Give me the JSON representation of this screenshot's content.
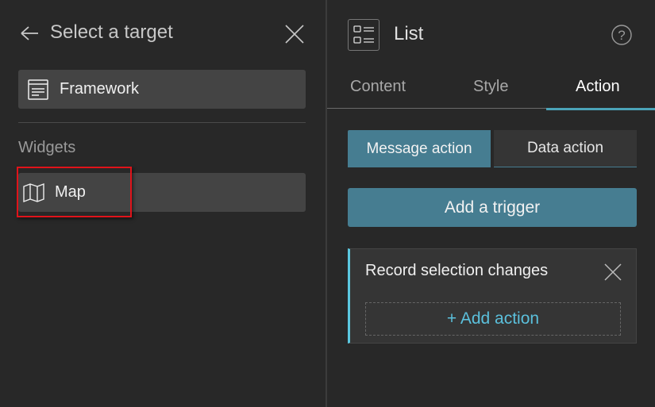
{
  "left_panel": {
    "title": "Select a target",
    "framework_label": "Framework",
    "section_label": "Widgets",
    "widgets": [
      {
        "label": "Map",
        "icon": "map-icon"
      }
    ]
  },
  "right_panel": {
    "widget_name": "List",
    "tabs": [
      {
        "label": "Content"
      },
      {
        "label": "Style"
      },
      {
        "label": "Action",
        "active": true
      }
    ],
    "action_types": [
      {
        "label": "Message action",
        "active": true
      },
      {
        "label": "Data action"
      }
    ],
    "add_trigger_label": "Add a trigger",
    "trigger_card": {
      "title": "Record selection changes",
      "add_action_label": "+ Add action"
    }
  },
  "colors": {
    "accent": "#467d91",
    "highlight": "#5bc8e0",
    "selection_box": "#e0131a"
  }
}
